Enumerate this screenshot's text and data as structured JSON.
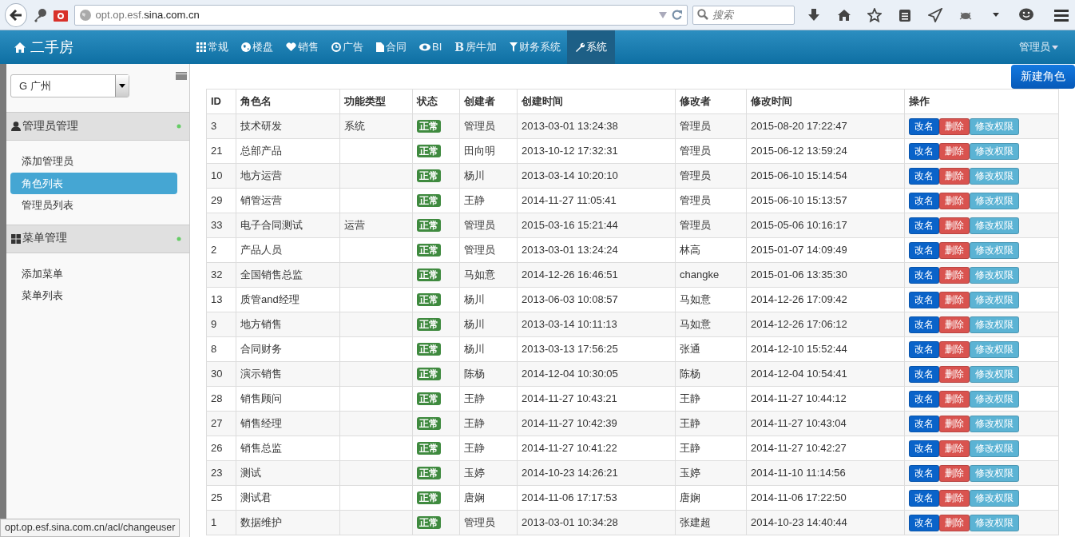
{
  "browser": {
    "url_host_prefix": "opt.op.esf.",
    "url_host_domain": "sina.com.cn",
    "search_placeholder": "搜索"
  },
  "navbar": {
    "brand": "二手房",
    "items": [
      {
        "label": "常规",
        "selected": false
      },
      {
        "label": "楼盘",
        "selected": false
      },
      {
        "label": "销售",
        "selected": false
      },
      {
        "label": "广告",
        "selected": false
      },
      {
        "label": "合同",
        "selected": false
      },
      {
        "label": "BI",
        "selected": false
      },
      {
        "label": "房牛加",
        "glyph": "B",
        "selected": false
      },
      {
        "label": "财务系统",
        "selected": false
      },
      {
        "label": "系统",
        "selected": true
      }
    ],
    "user": "管理员"
  },
  "sidebar": {
    "city": "G 广州",
    "sections": [
      {
        "title": "管理员管理",
        "items": [
          {
            "label": "添加管理员",
            "selected": false
          },
          {
            "label": "角色列表",
            "selected": true
          },
          {
            "label": "管理员列表",
            "selected": false
          }
        ]
      },
      {
        "title": "菜单管理",
        "items": [
          {
            "label": "添加菜单",
            "selected": false
          },
          {
            "label": "菜单列表",
            "selected": false
          }
        ]
      }
    ]
  },
  "new_button": "新建角色",
  "table": {
    "columns": [
      "ID",
      "角色名",
      "功能类型",
      "状态",
      "创建者",
      "创建时间",
      "修改者",
      "修改时间",
      "操作"
    ],
    "rows": [
      {
        "id": "3",
        "name": "技术研发",
        "type": "系统",
        "status": "正常",
        "creator": "管理员",
        "created": "2013-03-01 13:24:38",
        "modifier": "管理员",
        "modified": "2015-08-20 17:22:47",
        "actions": [
          "改名",
          "删除",
          "修改权限"
        ]
      },
      {
        "id": "21",
        "name": "总部产品",
        "type": "",
        "status": "正常",
        "creator": "田向明",
        "created": "2013-10-12 17:32:31",
        "modifier": "管理员",
        "modified": "2015-06-12 13:59:24",
        "actions": [
          "改名",
          "删除",
          "修改权限"
        ]
      },
      {
        "id": "10",
        "name": "地方运营",
        "type": "",
        "status": "正常",
        "creator": "杨川",
        "created": "2013-03-14 10:20:10",
        "modifier": "管理员",
        "modified": "2015-06-10 15:14:54",
        "actions": [
          "改名",
          "删除",
          "修改权限"
        ]
      },
      {
        "id": "29",
        "name": "销管运营",
        "type": "",
        "status": "正常",
        "creator": "王静",
        "created": "2014-11-27 11:05:41",
        "modifier": "管理员",
        "modified": "2015-06-10 15:13:57",
        "actions": [
          "改名",
          "删除",
          "修改权限"
        ]
      },
      {
        "id": "33",
        "name": "电子合同测试",
        "type": "运营",
        "status": "正常",
        "creator": "管理员",
        "created": "2015-03-16 15:21:44",
        "modifier": "管理员",
        "modified": "2015-05-06 10:16:17",
        "actions": [
          "改名",
          "删除",
          "修改权限"
        ]
      },
      {
        "id": "2",
        "name": "产品人员",
        "type": "",
        "status": "正常",
        "creator": "管理员",
        "created": "2013-03-01 13:24:24",
        "modifier": "林高",
        "modified": "2015-01-07 14:09:49",
        "actions": [
          "改名",
          "删除",
          "修改权限"
        ]
      },
      {
        "id": "32",
        "name": "全国销售总监",
        "type": "",
        "status": "正常",
        "creator": "马如意",
        "created": "2014-12-26 16:46:51",
        "modifier": "changke",
        "modified": "2015-01-06 13:35:30",
        "actions": [
          "改名",
          "删除",
          "修改权限"
        ]
      },
      {
        "id": "13",
        "name": "质管and经理",
        "type": "",
        "status": "正常",
        "creator": "杨川",
        "created": "2013-06-03 10:08:57",
        "modifier": "马如意",
        "modified": "2014-12-26 17:09:42",
        "actions": [
          "改名",
          "删除",
          "修改权限"
        ]
      },
      {
        "id": "9",
        "name": "地方销售",
        "type": "",
        "status": "正常",
        "creator": "杨川",
        "created": "2013-03-14 10:11:13",
        "modifier": "马如意",
        "modified": "2014-12-26 17:06:12",
        "actions": [
          "改名",
          "删除",
          "修改权限"
        ]
      },
      {
        "id": "8",
        "name": "合同财务",
        "type": "",
        "status": "正常",
        "creator": "杨川",
        "created": "2013-03-13 17:56:25",
        "modifier": "张通",
        "modified": "2014-12-10 15:52:44",
        "actions": [
          "改名",
          "删除",
          "修改权限"
        ]
      },
      {
        "id": "30",
        "name": "演示销售",
        "type": "",
        "status": "正常",
        "creator": "陈杨",
        "created": "2014-12-04 10:30:05",
        "modifier": "陈杨",
        "modified": "2014-12-04 10:54:41",
        "actions": [
          "改名",
          "删除",
          "修改权限"
        ]
      },
      {
        "id": "28",
        "name": "销售顾问",
        "type": "",
        "status": "正常",
        "creator": "王静",
        "created": "2014-11-27 10:43:21",
        "modifier": "王静",
        "modified": "2014-11-27 10:44:12",
        "actions": [
          "改名",
          "删除",
          "修改权限"
        ]
      },
      {
        "id": "27",
        "name": "销售经理",
        "type": "",
        "status": "正常",
        "creator": "王静",
        "created": "2014-11-27 10:42:39",
        "modifier": "王静",
        "modified": "2014-11-27 10:43:04",
        "actions": [
          "改名",
          "删除",
          "修改权限"
        ]
      },
      {
        "id": "26",
        "name": "销售总监",
        "type": "",
        "status": "正常",
        "creator": "王静",
        "created": "2014-11-27 10:41:22",
        "modifier": "王静",
        "modified": "2014-11-27 10:42:27",
        "actions": [
          "改名",
          "删除",
          "修改权限"
        ]
      },
      {
        "id": "23",
        "name": "测试",
        "type": "",
        "status": "正常",
        "creator": "玉婷",
        "created": "2014-10-23 14:26:21",
        "modifier": "玉婷",
        "modified": "2014-11-10 11:14:56",
        "actions": [
          "改名",
          "删除",
          "修改权限"
        ]
      },
      {
        "id": "25",
        "name": "测试君",
        "type": "",
        "status": "正常",
        "creator": "唐娴",
        "created": "2014-11-06 17:17:53",
        "modifier": "唐娴",
        "modified": "2014-11-06 17:22:50",
        "actions": [
          "改名",
          "删除",
          "修改权限"
        ]
      },
      {
        "id": "1",
        "name": "数据维护",
        "type": "",
        "status": "正常",
        "creator": "管理员",
        "created": "2013-03-01 10:34:28",
        "modifier": "张建超",
        "modified": "2014-10-23 14:40:44",
        "actions": [
          "改名",
          "删除",
          "修改权限"
        ]
      }
    ]
  },
  "status_bar": "opt.op.esf.sina.com.cn/acl/changeuser"
}
